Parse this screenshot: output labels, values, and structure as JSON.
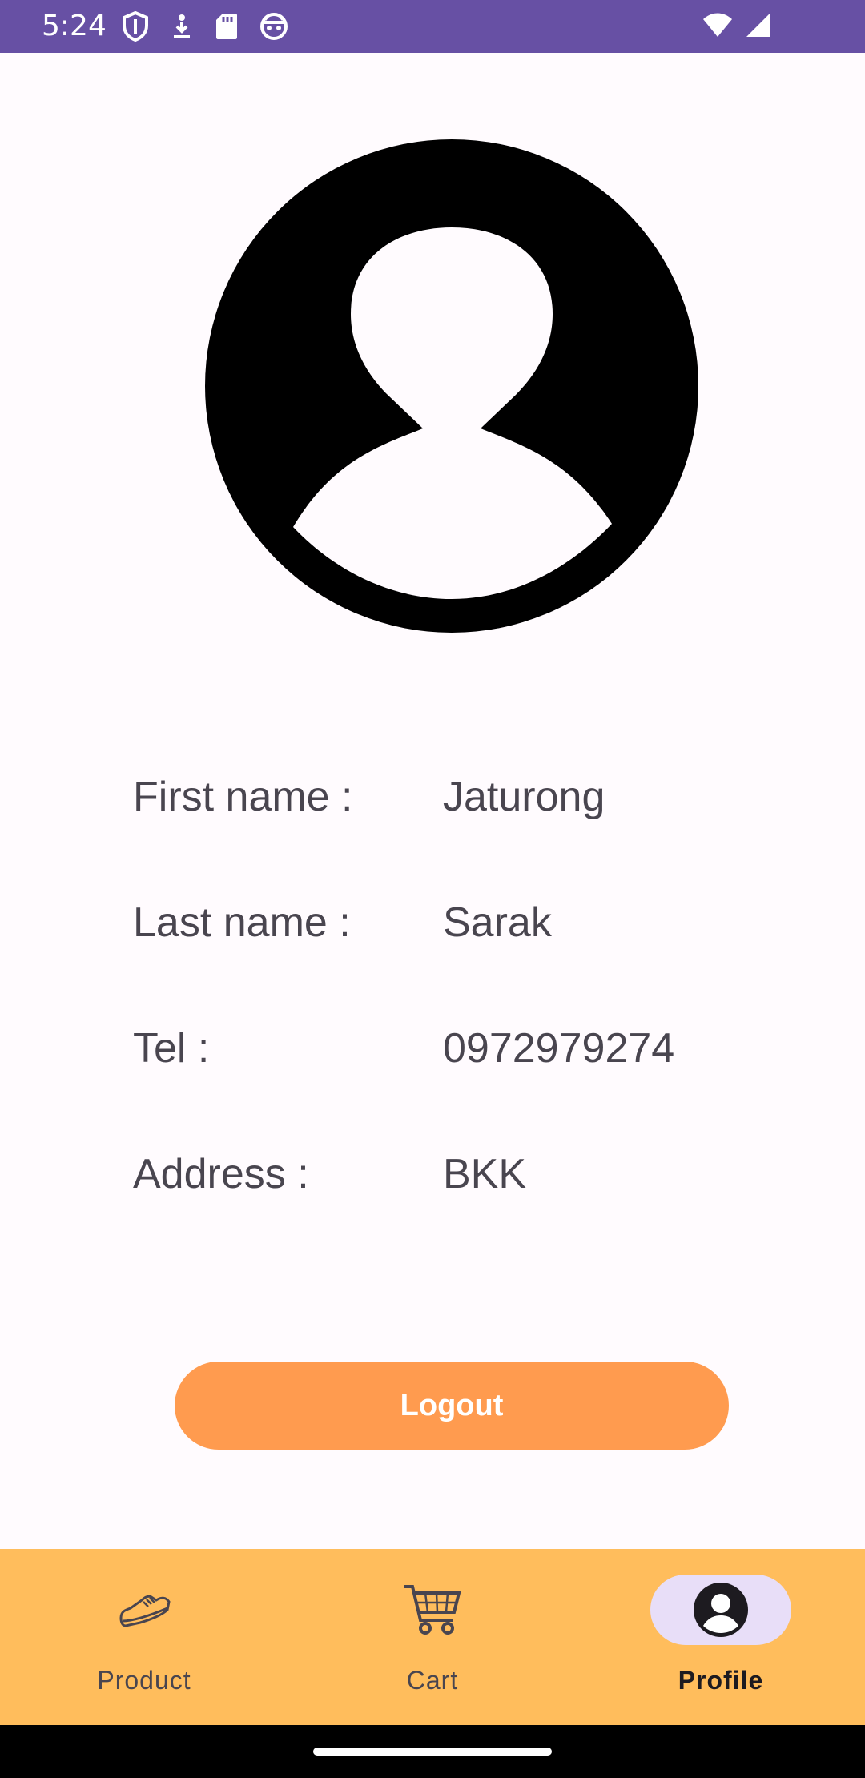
{
  "status_bar": {
    "time": "5:24",
    "left_icons": [
      "shield-icon",
      "download-icon",
      "sd-card-icon",
      "android-face-icon"
    ],
    "right_icons": [
      "wifi-icon",
      "cellular-signal-icon"
    ],
    "color": "#6750a4"
  },
  "profile": {
    "avatar_icon": "person-circle-icon",
    "fields": [
      {
        "label": "First name :",
        "value": "Jaturong"
      },
      {
        "label": "Last name :",
        "value": "Sarak"
      },
      {
        "label": "Tel :",
        "value": "0972979274"
      },
      {
        "label": "Address :",
        "value": "BKK"
      }
    ]
  },
  "logout": {
    "label": "Logout",
    "color": "#ff9b4f"
  },
  "bottom_nav": {
    "color": "#ffbd5c",
    "items": [
      {
        "label": "Product",
        "icon": "sneaker-icon",
        "active": false
      },
      {
        "label": "Cart",
        "icon": "shopping-cart-icon",
        "active": false
      },
      {
        "label": "Profile",
        "icon": "profile-icon",
        "active": true
      }
    ]
  }
}
